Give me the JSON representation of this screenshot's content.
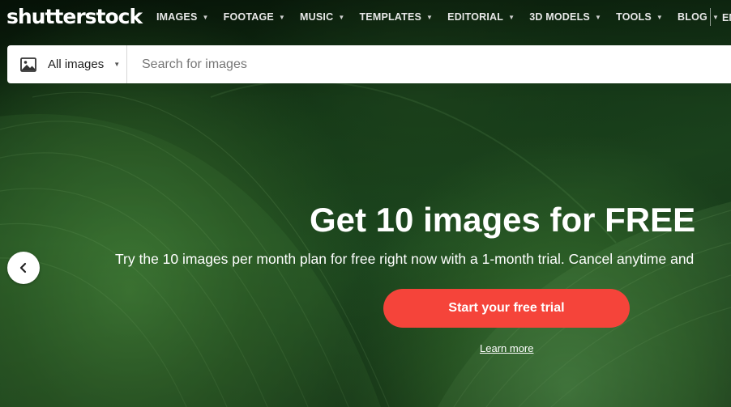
{
  "brand": {
    "logo_text": "shutterstock"
  },
  "nav": {
    "items": [
      {
        "label": "IMAGES"
      },
      {
        "label": "FOOTAGE"
      },
      {
        "label": "MUSIC"
      },
      {
        "label": "TEMPLATES"
      },
      {
        "label": "EDITORIAL"
      },
      {
        "label": "3D MODELS"
      },
      {
        "label": "TOOLS"
      },
      {
        "label": "BLOG"
      }
    ],
    "language": "EN"
  },
  "search": {
    "media_type": "All images",
    "media_icon": "image-icon",
    "placeholder": "Search for images",
    "value": ""
  },
  "hero": {
    "title": "Get 10 images for FREE",
    "subtitle": "Try the 10 images per month plan for free right now with a 1-month trial. Cancel anytime and",
    "cta_label": "Start your free trial",
    "learn_more": "Learn more"
  },
  "carousel": {
    "prev_icon": "chevron-left-icon"
  },
  "colors": {
    "cta": "#f5443a",
    "text_light": "#ffffff",
    "search_bg": "#ffffff",
    "hero_green": "#2a5a25"
  }
}
